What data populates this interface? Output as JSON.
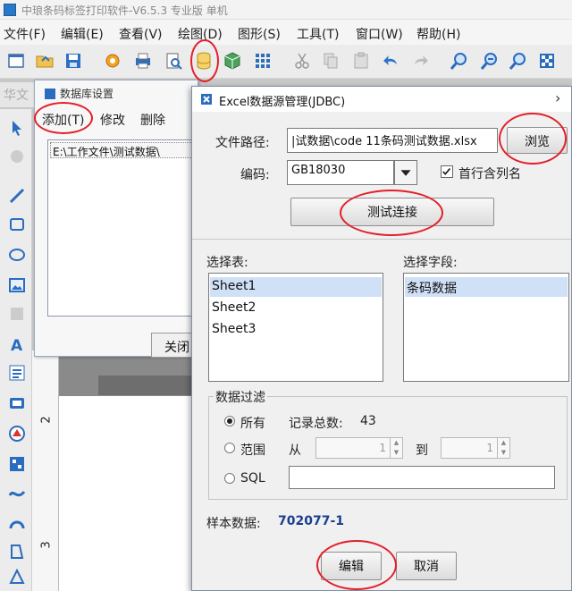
{
  "app": {
    "title": "中琅条码标签打印软件-V6.5.3 专业版 单机"
  },
  "menu": [
    {
      "label": "文件(F)"
    },
    {
      "label": "编辑(E)"
    },
    {
      "label": "查看(V)"
    },
    {
      "label": "绘图(D)"
    },
    {
      "label": "图形(S)"
    },
    {
      "label": "工具(T)"
    },
    {
      "label": "窗口(W)"
    },
    {
      "label": "帮助(H)"
    }
  ],
  "toolbar_icons": [
    "new-icon",
    "open-icon",
    "save-icon",
    "settings-icon",
    "print-icon",
    "print-preview-icon",
    "database-icon",
    "cube-icon",
    "grid-icon",
    "cut-icon",
    "copy-icon",
    "paste-icon",
    "undo-icon",
    "redo-icon",
    "zoom-in-icon",
    "zoom-out-icon",
    "zoom-fit-icon",
    "zoom-actual-icon"
  ],
  "font_label": "华文",
  "ruler": {
    "marks": [
      "2",
      "3"
    ]
  },
  "db_settings": {
    "title": "数据库设置",
    "tabs": {
      "add": "添加(T)",
      "edit": "修改",
      "delete": "删除"
    },
    "list": [
      "E:\\工作文件\\测试数据\\"
    ],
    "close_label": "关闭"
  },
  "dialog": {
    "title": "Excel数据源管理(JDBC)",
    "close_glyph": "›",
    "file_path_label": "文件路径:",
    "file_path_value": "|试数据\\code 11条码测试数据.xlsx",
    "browse_label": "浏览",
    "encoding_label": "编码:",
    "encoding_value": "GB18030",
    "first_row_label": "首行含列名",
    "first_row_checked": true,
    "test_connection_label": "测试连接",
    "select_table_label": "选择表:",
    "tables": [
      "Sheet1",
      "Sheet2",
      "Sheet3"
    ],
    "selected_table": "Sheet1",
    "select_field_label": "选择字段:",
    "fields": [
      "条码数据"
    ],
    "filter": {
      "title": "数据过滤",
      "all_label": "所有",
      "total_label": "记录总数:",
      "total_value": "43",
      "range_label": "范围",
      "from_label": "从",
      "from_value": "1",
      "to_label": "到",
      "to_value": "1",
      "sql_label": "SQL",
      "selected": "all"
    },
    "sample_label": "样本数据:",
    "sample_value": "702077-1",
    "edit_label": "编辑",
    "cancel_label": "取消"
  },
  "colors": {
    "annotation": "#e2202a",
    "sample_value": "#1a3f8f",
    "selection": "#cfe0f7"
  }
}
